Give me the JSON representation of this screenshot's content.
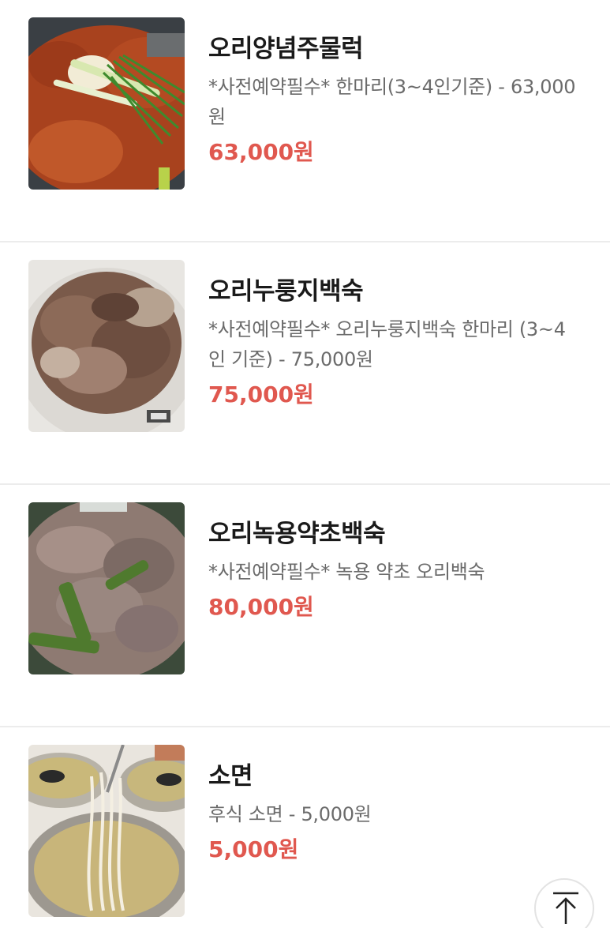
{
  "menu": {
    "items": [
      {
        "name": "오리양념주물럭",
        "description": "*사전예약필수* 한마리(3~4인기준) - 63,000원",
        "price": "63,000원",
        "image_icon": "spicy-duck-bulgogi-photo"
      },
      {
        "name": "오리누룽지백숙",
        "description": "*사전예약필수* 오리누룽지백숙 한마리 (3~4인 기준) - 75,000원",
        "price": "75,000원",
        "image_icon": "duck-nurungji-baeksuk-photo"
      },
      {
        "name": "오리녹용약초백숙",
        "description": "*사전예약필수* 녹용 약초 오리백숙",
        "price": "80,000원",
        "image_icon": "duck-herbal-baeksuk-photo"
      },
      {
        "name": "소면",
        "description": "후식 소면 - 5,000원",
        "price": "5,000원",
        "image_icon": "somyeon-noodle-photo"
      }
    ]
  },
  "scroll_top": {
    "icon": "arrow-up-to-top-icon"
  },
  "colors": {
    "price": "#e0584f",
    "title": "#1a1a1a",
    "description": "#6b6b6b",
    "divider": "#ececec"
  }
}
